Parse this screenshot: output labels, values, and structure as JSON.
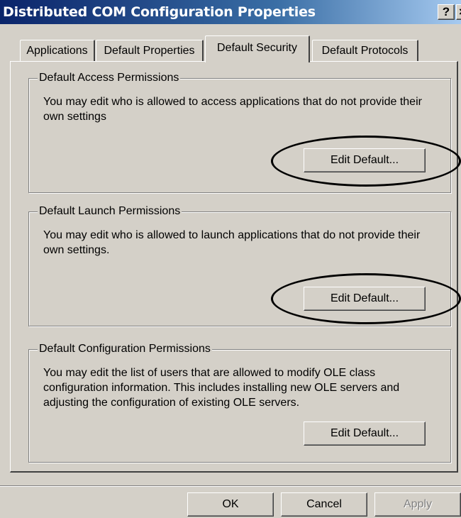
{
  "window": {
    "title": "Distributed COM Configuration Properties",
    "help_glyph": "?",
    "close_glyph": "×"
  },
  "tabs": [
    {
      "label": "Applications",
      "active": false
    },
    {
      "label": "Default Properties",
      "active": false
    },
    {
      "label": "Default Security",
      "active": true
    },
    {
      "label": "Default Protocols",
      "active": false
    }
  ],
  "groups": {
    "access": {
      "title": "Default Access Permissions",
      "description": "You may edit who is allowed to access applications that do not provide their own settings",
      "button_label": "Edit Default...",
      "highlighted": true
    },
    "launch": {
      "title": "Default Launch Permissions",
      "description": "You may edit who is allowed to launch applications that do not provide their own settings.",
      "button_label": "Edit Default...",
      "highlighted": true
    },
    "configuration": {
      "title": "Default Configuration Permissions",
      "description": "You may edit the list of users that are allowed to modify OLE class configuration information.  This includes installing new OLE servers and adjusting the configuration of existing OLE servers.",
      "button_label": "Edit Default...",
      "highlighted": false
    }
  },
  "footer": {
    "ok_label": "OK",
    "cancel_label": "Cancel",
    "apply_label": "Apply",
    "apply_enabled": false
  },
  "colors": {
    "title_bar": "#0a246a",
    "face": "#d4d0c8",
    "annotation": "#000000"
  }
}
